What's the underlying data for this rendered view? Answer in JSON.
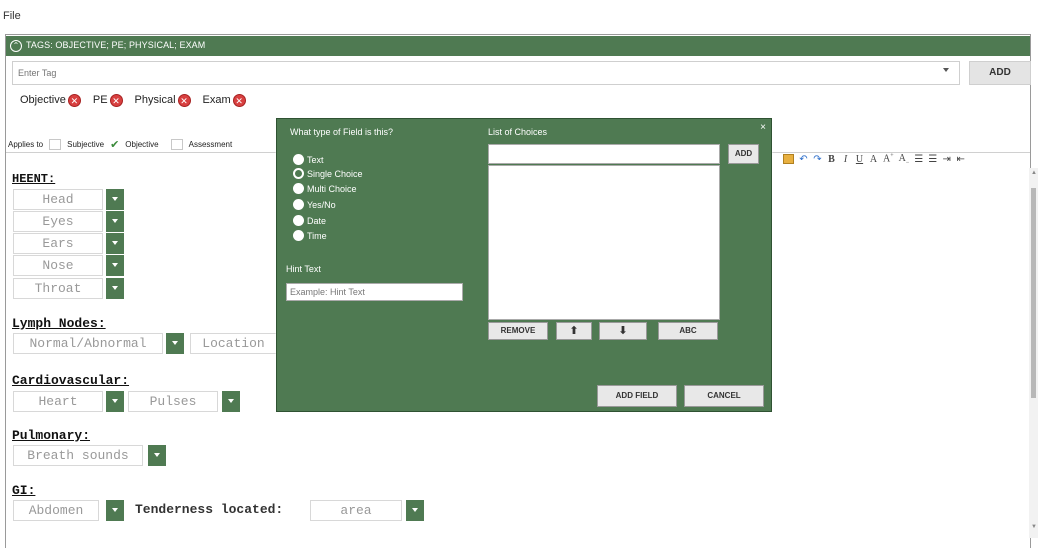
{
  "menu": {
    "file": "File"
  },
  "tag_header": {
    "label": "TAGS: OBJECTIVE; PE; PHYSICAL; EXAM"
  },
  "tag_input": {
    "placeholder": "Enter Tag",
    "add_label": "ADD"
  },
  "tags": [
    "Objective",
    "PE",
    "Physical",
    "Exam"
  ],
  "applies": {
    "label": "Applies to",
    "subjective": "Subjective",
    "objective": "Objective",
    "assessment": "Assessment"
  },
  "editor": {
    "heent": {
      "title": "HEENT:",
      "fields": [
        "Head",
        "Eyes",
        "Ears",
        "Nose",
        "Throat"
      ]
    },
    "lymph": {
      "title": "Lymph Nodes:",
      "field": "Normal/Abnormal",
      "location": "Location"
    },
    "cardio": {
      "title": "Cardiovascular:",
      "heart": "Heart",
      "pulses": "Pulses"
    },
    "pulmonary": {
      "title": "Pulmonary:",
      "field": "Breath sounds"
    },
    "gi": {
      "title": "GI:",
      "abdomen": "Abdomen",
      "tenderness": "Tenderness located:",
      "area": "area"
    }
  },
  "toolbar": {
    "bold": "B",
    "italic": "I",
    "underline": "U",
    "font_a": "A"
  },
  "modal": {
    "field_type_title": "What type of Field is this?",
    "types": [
      "Text",
      "Single Choice",
      "Multi Choice",
      "Yes/No",
      "Date",
      "Time"
    ],
    "selected_type": "Single Choice",
    "hint_title": "Hint Text",
    "hint_placeholder": "Example: Hint Text",
    "choices_title": "List of Choices",
    "add": "ADD",
    "remove": "REMOVE",
    "abc": "ABC",
    "add_field": "ADD FIELD",
    "cancel": "CANCEL",
    "close": "×"
  },
  "colors": {
    "accent_green": "#4f7a52",
    "remove_red": "#d84040"
  }
}
